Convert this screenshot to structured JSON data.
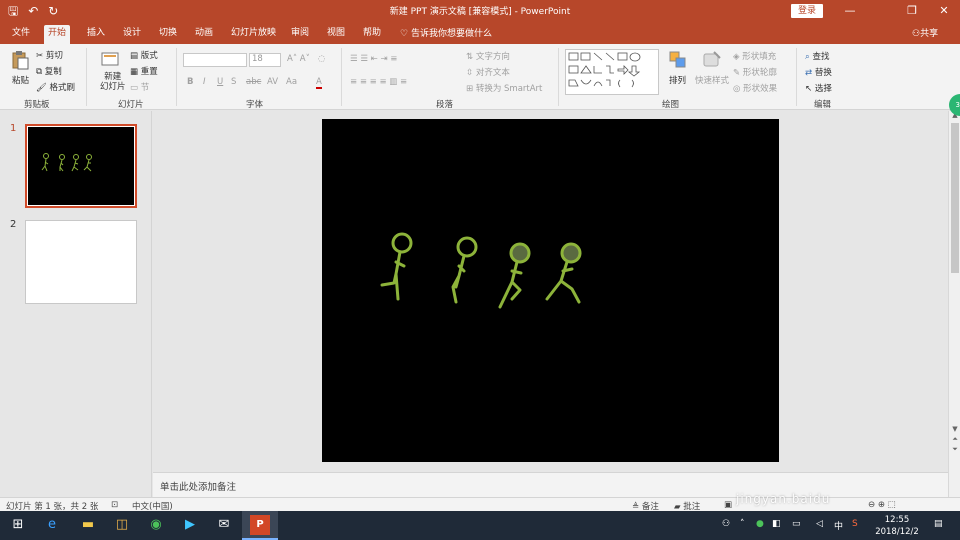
{
  "window": {
    "title": "新建 PPT 演示文稿 [兼容模式]  -  PowerPoint",
    "login": "登录",
    "minimize": "—",
    "restore": "❐",
    "close": "✕"
  },
  "qat": {
    "save": "🖫",
    "undo": "↶",
    "redo": "↻"
  },
  "tabs": [
    "文件",
    "开始",
    "插入",
    "设计",
    "切换",
    "动画",
    "幻灯片放映",
    "审阅",
    "视图",
    "帮助"
  ],
  "tell_me": "告诉我你想要做什么",
  "share": "共享",
  "ribbon": {
    "clipboard": {
      "paste": "粘贴",
      "cut": "剪切",
      "copy": "复制",
      "format_painter": "格式刷",
      "label": "剪贴板"
    },
    "slides": {
      "new_slide": "新建\n幻灯片",
      "new_slide_line1": "新建",
      "new_slide_line2": "幻灯片",
      "layout": "版式",
      "reset": "重置",
      "section": "节",
      "label": "幻灯片"
    },
    "font": {
      "font_name": "",
      "font_size": "18",
      "bold": "B",
      "italic": "I",
      "underline": "U",
      "strike": "S",
      "spacing": "abc",
      "case": "Aa",
      "color": "A",
      "label": "字体"
    },
    "paragraph": {
      "text_direction": "文字方向",
      "align_text": "对齐文本",
      "smartart": "转换为 SmartArt",
      "label": "段落"
    },
    "drawing": {
      "arrange": "排列",
      "quick_styles": "快速样式",
      "fill": "形状填充",
      "outline": "形状轮廓",
      "effects": "形状效果",
      "label": "绘图"
    },
    "editing": {
      "find": "查找",
      "replace": "替换",
      "select": "选择",
      "label": "编辑"
    }
  },
  "thumbnails": [
    {
      "number": "1",
      "selected": true
    },
    {
      "number": "2",
      "selected": false
    }
  ],
  "notes_placeholder": "单击此处添加备注",
  "status": {
    "slide_info": "幻灯片 第 1 张，共 2 张",
    "language": "中文(中国)",
    "notes": "备注",
    "comments": "批注"
  },
  "badge": "39",
  "watermark": "jingyan.baidu",
  "taskbar": {
    "time": "12:55",
    "date": "2018/12/2",
    "ime": "中"
  },
  "colors": {
    "accent": "#b7472a",
    "figure": "#8db33a"
  }
}
